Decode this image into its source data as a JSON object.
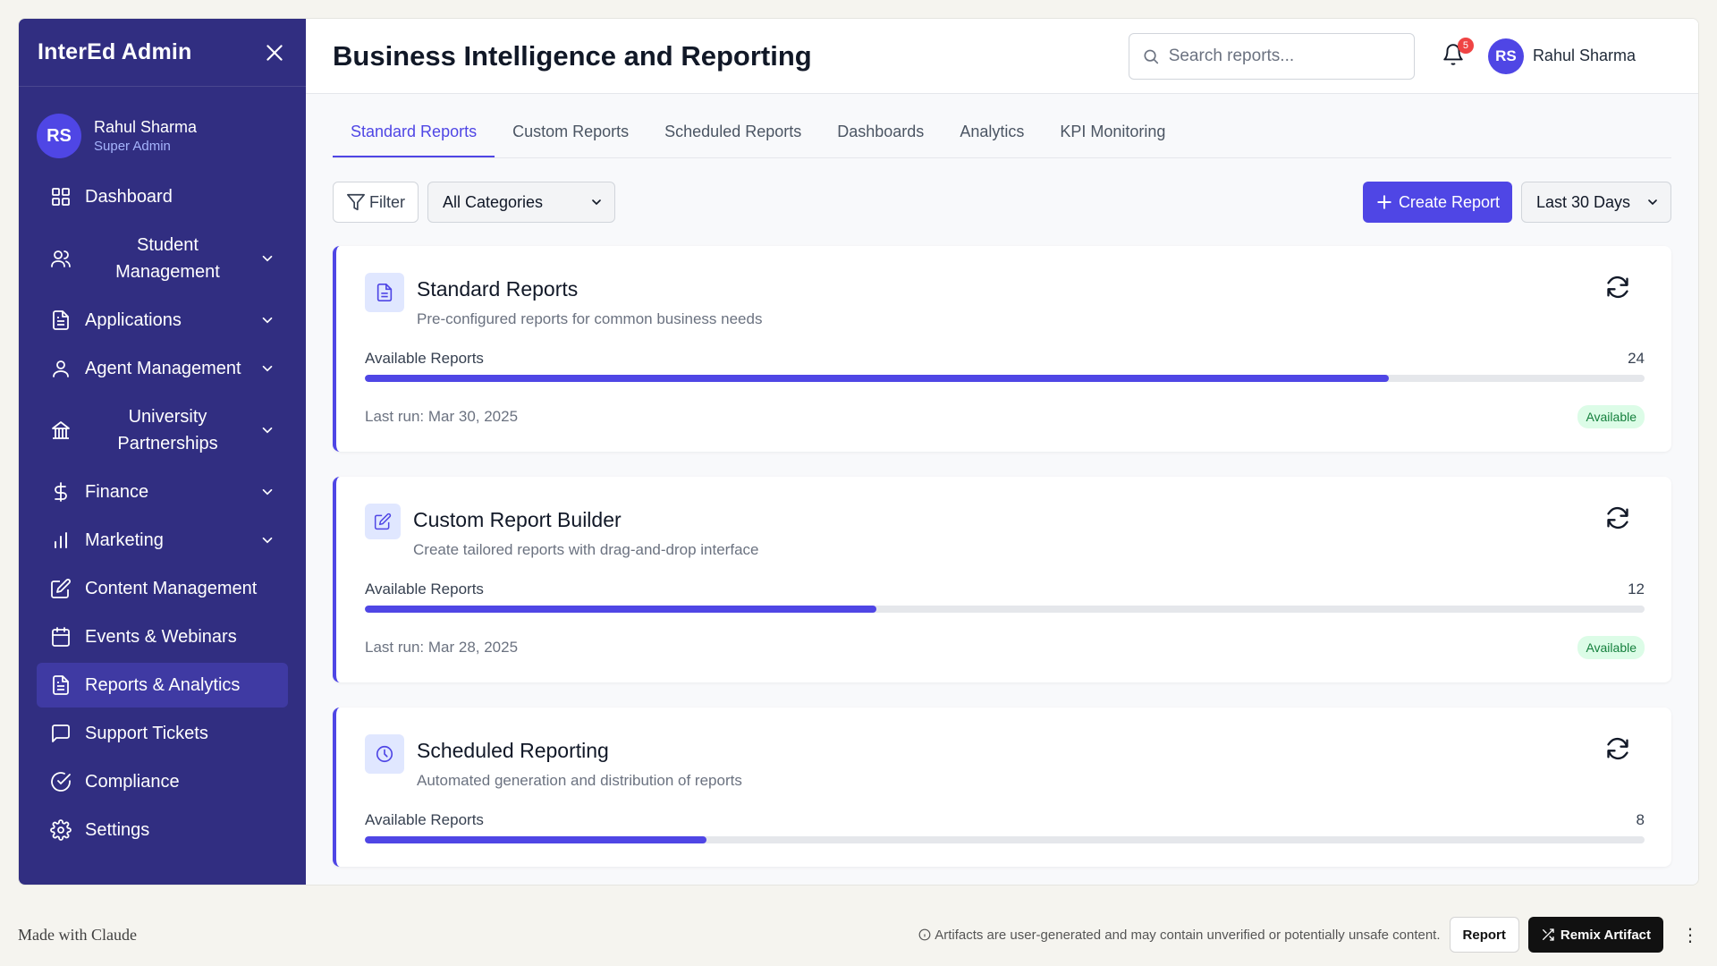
{
  "sidebar": {
    "title": "InterEd Admin",
    "user": {
      "initials": "RS",
      "name": "Rahul Sharma",
      "role": "Super Admin"
    },
    "items": [
      {
        "label": "Dashboard",
        "icon": "grid-icon"
      },
      {
        "label": "Student Management",
        "icon": "users-icon"
      },
      {
        "label": "Applications",
        "icon": "file-icon"
      },
      {
        "label": "Agent Management",
        "icon": "user-icon"
      },
      {
        "label": "University Partnerships",
        "icon": "building-icon"
      },
      {
        "label": "Finance",
        "icon": "dollar-icon"
      },
      {
        "label": "Marketing",
        "icon": "bar-chart-icon"
      },
      {
        "label": "Content Management",
        "icon": "edit-icon"
      },
      {
        "label": "Events & Webinars",
        "icon": "calendar-icon"
      },
      {
        "label": "Reports & Analytics",
        "icon": "file-icon"
      },
      {
        "label": "Support Tickets",
        "icon": "message-icon"
      },
      {
        "label": "Compliance",
        "icon": "check-circle-icon"
      },
      {
        "label": "Settings",
        "icon": "gear-icon"
      }
    ]
  },
  "header": {
    "title": "Business Intelligence and Reporting",
    "search_placeholder": "Search reports...",
    "notification_count": "5",
    "user_initials": "RS",
    "user_name": "Rahul Sharma"
  },
  "tabs": [
    "Standard Reports",
    "Custom Reports",
    "Scheduled Reports",
    "Dashboards",
    "Analytics",
    "KPI Monitoring"
  ],
  "toolbar": {
    "filter_label": "Filter",
    "category_selected": "All Categories",
    "create_label": "Create Report",
    "range_selected": "Last 30 Days"
  },
  "cards": [
    {
      "title": "Standard Reports",
      "description": "Pre-configured reports for common business needs",
      "available_label": "Available Reports",
      "count": "24",
      "fill_fraction": 0.8,
      "last_run": "Last run: Mar 30, 2025",
      "status": "Available"
    },
    {
      "title": "Custom Report Builder",
      "description": "Create tailored reports with drag-and-drop interface",
      "available_label": "Available Reports",
      "count": "12",
      "fill_fraction": 0.4,
      "last_run": "Last run: Mar 28, 2025",
      "status": "Available"
    },
    {
      "title": "Scheduled Reporting",
      "description": "Automated generation and distribution of reports",
      "available_label": "Available Reports",
      "count": "8",
      "fill_fraction": 0.267
    }
  ],
  "footer": {
    "made_with": "Made with Claude",
    "disclaimer": "Artifacts are user-generated and may contain unverified or potentially unsafe content.",
    "report_label": "Report",
    "remix_label": "Remix Artifact"
  },
  "colors": {
    "sidebar": "#312e81",
    "accent": "#4f46e5",
    "badge_bg": "#dcfce7",
    "badge_text": "#15803d"
  }
}
